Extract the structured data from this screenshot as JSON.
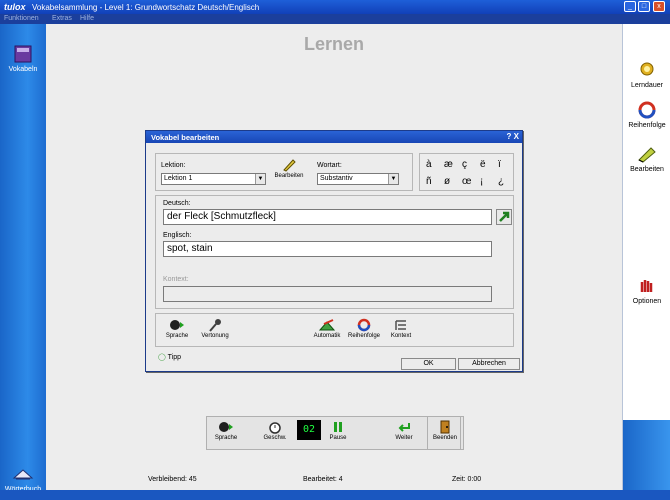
{
  "window": {
    "logo": "tulox",
    "title": "Vokabelsammlung - Level 1: Grundwortschatz Deutsch/Englisch"
  },
  "menu": [
    "Funktionen",
    "Extras",
    "Hilfe"
  ],
  "left": {
    "vokabeln": "Vokabeln",
    "woerterbuch": "Wörterbuch"
  },
  "heading": "Lernen",
  "right": {
    "lerndauer": "Lerndauer",
    "reihenfolge": "Reihenfolge",
    "bearbeiten": "Bearbeiten",
    "optionen": "Optionen"
  },
  "dialog": {
    "title": "Vokabel bearbeiten",
    "title_controls": "? X",
    "lektion_label": "Lektion:",
    "lektion_value": "Lektion 1",
    "bearbeiten_label": "Bearbeiten",
    "wortart_label": "Wortart:",
    "wortart_value": "Substantiv",
    "chars_row1": [
      "à",
      "æ",
      "ç",
      "ë",
      "ï"
    ],
    "chars_row2": [
      "ñ",
      "ø",
      "œ",
      "¡",
      "¿"
    ],
    "deutsch_label": "Deutsch:",
    "deutsch_value": "der Fleck [Schmutzfleck]",
    "englisch_label": "Englisch:",
    "englisch_value": "spot, stain",
    "kontext_label": "Kontext:",
    "kontext_value": "",
    "tools": {
      "sprache": "Sprache",
      "vertonung": "Vertonung",
      "automatik": "Automatik",
      "reihenfolge": "Reihenfolge",
      "kontext": "Kontext"
    },
    "tipp": "Tipp",
    "ok": "OK",
    "abbrechen": "Abbrechen"
  },
  "toolbar": {
    "sprache": "Sprache",
    "geschw": "Geschw.",
    "counter": "02",
    "pause": "Pause",
    "weiter": "Weiter",
    "beenden": "Beenden"
  },
  "status": {
    "verbleibend": "Verbleibend: 45",
    "bearbeitet": "Bearbeitet: 4",
    "zeit": "Zeit: 0:00"
  }
}
